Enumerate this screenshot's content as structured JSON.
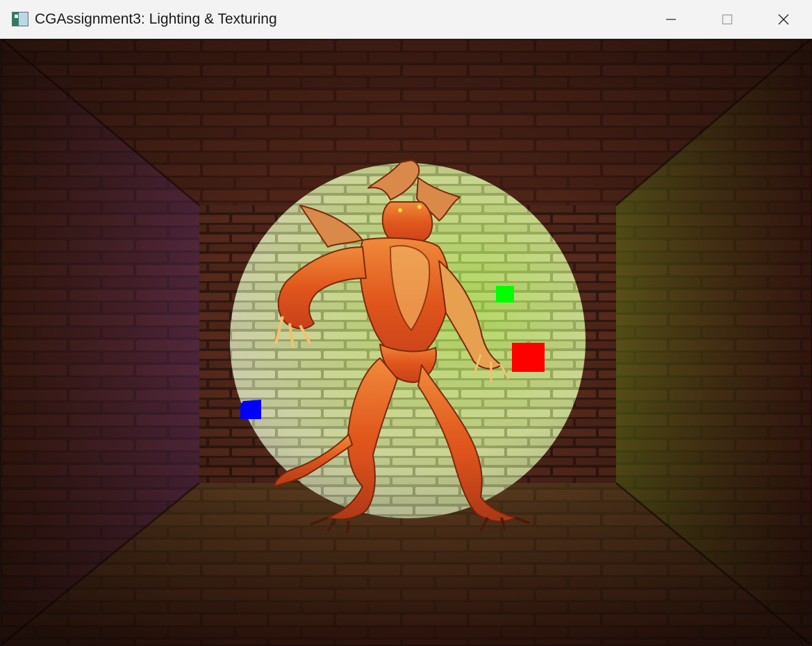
{
  "window": {
    "title": "CGAssignment3: Lighting & Texturing",
    "icon": "opengl-app-icon",
    "controls": [
      "minimize-icon",
      "maximize-icon",
      "close-icon"
    ]
  },
  "scene": {
    "description_colors": {
      "wall_tint": "#5a2a1c",
      "spotlight_tint": "#c8e07a",
      "model_color": "#e0561c"
    },
    "light_markers": [
      {
        "name": "green",
        "color": "#00ff00"
      },
      {
        "name": "red",
        "color": "#ff0000"
      },
      {
        "name": "blue",
        "color": "#0000ff"
      }
    ]
  }
}
